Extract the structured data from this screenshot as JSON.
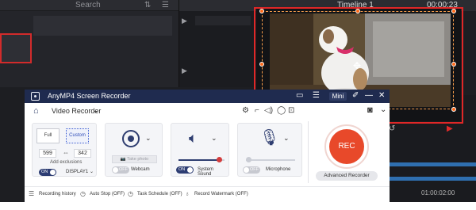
{
  "editor": {
    "search_label": "Search",
    "timeline_title": "Timeline 1",
    "timecode_top": "00:00:23",
    "timecode_bottom": "01:00:02:00"
  },
  "recorder": {
    "app_title": "AnyMP4 Screen Recorder",
    "mini_label": "Mini",
    "mode_label": "Video Recorder",
    "area": {
      "full_label": "Full",
      "custom_label": "Custom",
      "width": "599",
      "height": "342",
      "exclusions_label": "Add exclusions",
      "toggle_label": "ON",
      "display_label": "DISPLAY1"
    },
    "webcam": {
      "take_photo_label": "Take photo",
      "toggle_label": "OFF",
      "label": "Webcam"
    },
    "system_sound": {
      "toggle_label": "ON",
      "label": "System Sound",
      "volume_fraction": 0.88
    },
    "microphone": {
      "toggle_label": "OFF",
      "label": "Microphone",
      "volume_fraction": 0.0
    },
    "rec_label": "REC",
    "advanced_label": "Advanced Recorder",
    "footer": {
      "recording_history": "Recording history",
      "auto_stop": "Auto Stop (OFF)",
      "task_schedule": "Task Schedule (OFF)",
      "record_watermark": "Record Watermark (OFF)"
    }
  },
  "colors": {
    "title_bar": "#1f2b4f",
    "accent_navy": "#2e3d70",
    "rec_red": "#e8492a",
    "frame_red": "#e02727",
    "handle_orange": "#ff6a1a"
  },
  "icons": [
    "home-icon",
    "settings-icon",
    "speaker-icon",
    "microphone-icon",
    "webcam-icon",
    "camera-icon",
    "move-icon",
    "history-icon",
    "clock-icon",
    "calendar-icon",
    "watermark-icon"
  ]
}
